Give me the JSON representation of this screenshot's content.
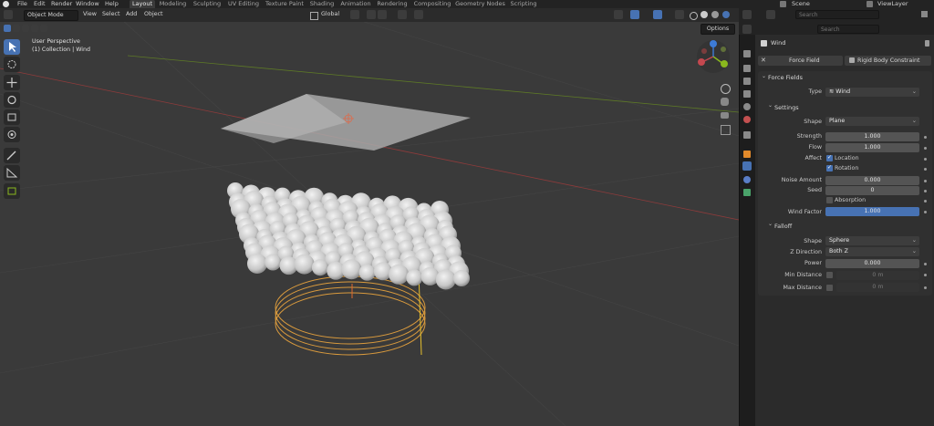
{
  "menu": {
    "items": [
      "File",
      "Edit",
      "Render",
      "Window",
      "Help"
    ]
  },
  "workspaces": [
    "Layout",
    "Modeling",
    "Sculpting",
    "UV Editing",
    "Texture Paint",
    "Shading",
    "Animation",
    "Rendering",
    "Compositing",
    "Geometry Nodes",
    "Scripting"
  ],
  "active_workspace": "Layout",
  "scene": {
    "name": "Scene",
    "view_layer": "ViewLayer"
  },
  "viewport": {
    "mode": "Object Mode",
    "menus": [
      "View",
      "Select",
      "Add",
      "Object"
    ],
    "transform_orientation": "Global",
    "options_label": "Options",
    "overlay_line1": "User Perspective",
    "overlay_line2": "(1) Collection | Wind"
  },
  "search_placeholder": "Search",
  "properties": {
    "object_name": "Wind",
    "tabs": [
      "Force Field",
      "Rigid Body Constraint"
    ],
    "force_fields": {
      "title": "Force Fields",
      "type_label": "Type",
      "type_value": "Wind",
      "settings": {
        "title": "Settings",
        "shape_label": "Shape",
        "shape_value": "Plane",
        "strength_label": "Strength",
        "strength_value": "1.000",
        "flow_label": "Flow",
        "flow_value": "1.000",
        "affect_label": "Affect",
        "location_label": "Location",
        "rotation_label": "Rotation",
        "noise_label": "Noise Amount",
        "noise_value": "0.000",
        "seed_label": "Seed",
        "seed_value": "0",
        "absorption_label": "Absorption",
        "wind_factor_label": "Wind Factor",
        "wind_factor_value": "1.000"
      },
      "falloff": {
        "title": "Falloff",
        "shape_label": "Shape",
        "shape_value": "Sphere",
        "zdir_label": "Z Direction",
        "zdir_value": "Both Z",
        "power_label": "Power",
        "power_value": "0.000",
        "min_label": "Min Distance",
        "min_value": "0 m",
        "max_label": "Max Distance",
        "max_value": "0 m"
      }
    }
  },
  "colors": {
    "accent": "#4772b3",
    "x_axis": "#c4484f",
    "y_axis": "#8ab81e",
    "z_axis": "#3d7bd6",
    "empty": "#e6c02d"
  }
}
